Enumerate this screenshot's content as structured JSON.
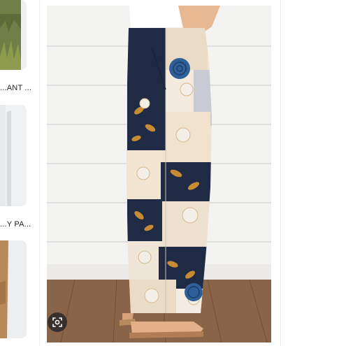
{
  "results": {
    "items": [
      {
        "label": "...ANT ...",
        "thumb_icon": "grass-photo-thumbnail"
      },
      {
        "label": "...Y PA...",
        "thumb_icon": "model-photo-thumbnail"
      },
      {
        "label": "",
        "thumb_icon": "arm-photo-thumbnail"
      }
    ]
  },
  "preview": {
    "image_icon": "patchwork-wide-leg-pants-photo",
    "lens_icon": "visual-search-lens-icon"
  },
  "colors": {
    "navy": "#1f2a44",
    "cream": "#efe4d3",
    "mustard": "#c98a34",
    "floor": "#8a6449",
    "wall": "#f3f3f1"
  }
}
